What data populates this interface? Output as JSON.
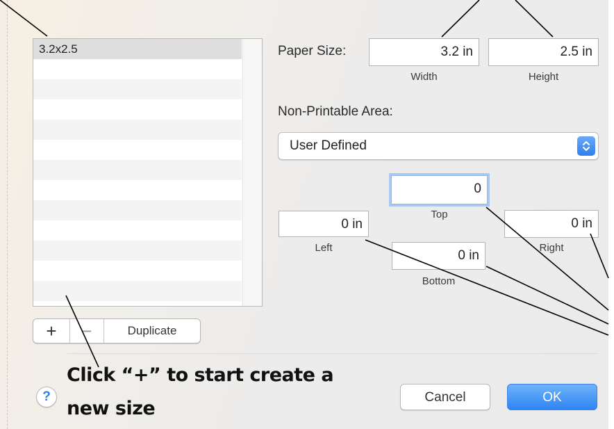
{
  "list": {
    "items": [
      "3.2x2.5"
    ]
  },
  "list_controls": {
    "add_label": "+",
    "remove_label": "−",
    "duplicate_label": "Duplicate"
  },
  "paper_size": {
    "label": "Paper Size:",
    "width_value": "3.2 in",
    "width_caption": "Width",
    "height_value": "2.5 in",
    "height_caption": "Height"
  },
  "non_printable": {
    "label": "Non-Printable Area:",
    "selected": "User Defined"
  },
  "margins": {
    "top_value": "0",
    "top_caption": "Top",
    "left_value": "0 in",
    "left_caption": "Left",
    "bottom_value": "0 in",
    "bottom_caption": "Bottom",
    "right_value": "0 in",
    "right_caption": "Right"
  },
  "buttons": {
    "help": "?",
    "cancel": "Cancel",
    "ok": "OK"
  },
  "annotation": {
    "line1": "Click “+” to start create a",
    "line2": "new size"
  },
  "colors": {
    "accent": "#2f85f2",
    "focus_ring": "#a9c9f2"
  }
}
